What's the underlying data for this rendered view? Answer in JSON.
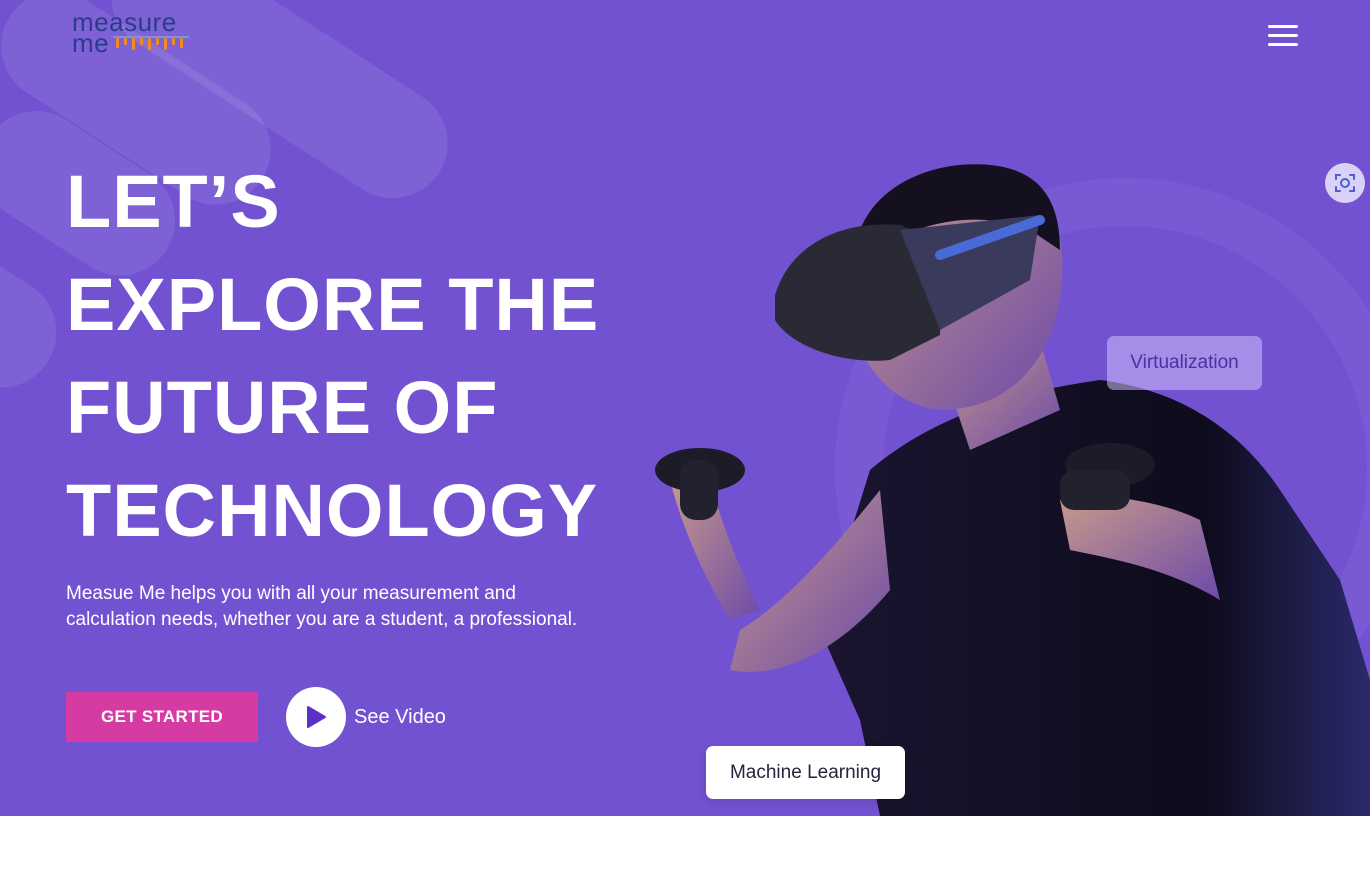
{
  "header": {
    "logo_line1": "measure",
    "logo_line2": "me",
    "logo_icon": "bar-meter-logo-icon",
    "menu_icon": "hamburger-menu-icon"
  },
  "hero": {
    "headline": [
      "LET’S",
      "EXPLORE THE",
      "FUTURE OF",
      "TECHNOLOGY"
    ],
    "description": "Measue Me helps you with all your measurement and calculation needs, whether you are a student, a professional.",
    "cta_label": "GET STARTED",
    "video_label": "See Video",
    "play_icon": "play-icon"
  },
  "floating_tags": {
    "virtualization": "Virtualization",
    "machine_learning": "Machine Learning"
  },
  "widgets": {
    "scan_icon": "screen-capture-icon"
  },
  "colors": {
    "hero_bg": "#7352d2",
    "cta_bg": "#d63ba4",
    "logo_blue": "#2a3c8c",
    "logo_orange": "#f28a1e"
  }
}
